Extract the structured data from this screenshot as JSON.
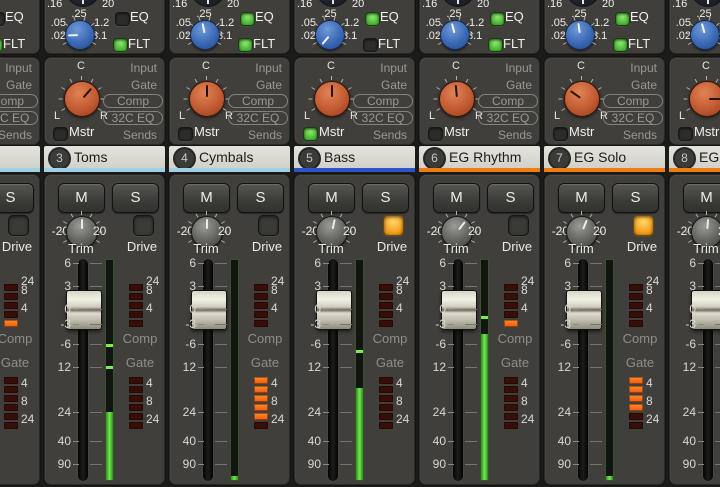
{
  "labels": {
    "top_left": ".16",
    "top_right": "20",
    "eq_scale": [
      ".05",
      ".25",
      "1.2",
      ".02",
      "3.1"
    ],
    "eq": "EQ",
    "flt": "FLT",
    "pan_center": "C",
    "pan_left": "L",
    "pan_right": "R",
    "route_buttons": [
      "Input",
      "Gate",
      "Comp",
      "32C EQ",
      "Sends"
    ],
    "mstr": "Mstr",
    "mute": "M",
    "solo": "S",
    "trim_min": "-20",
    "trim_max": "20",
    "trim": "Trim",
    "drive": "Drive",
    "fader_scale": [
      "6",
      "3",
      "0",
      "-3",
      "-6",
      "12",
      "24",
      "40",
      "90"
    ],
    "comp_title": "Comp",
    "gate_title": "Gate",
    "comp_scale": [
      "24",
      "8",
      "4"
    ],
    "gate_scale": [
      "4",
      "8",
      "24"
    ]
  },
  "channels": [
    {
      "number": "",
      "name": "",
      "accent": "#9fd0e8",
      "eq_angle": -90,
      "eq_led": false,
      "flt_led": true,
      "pan_angle": 0,
      "mstr_led": false,
      "trim_angle": 0,
      "drive_led": false,
      "meter": {
        "fill": 0,
        "peaks": []
      },
      "comp_lit": [
        false,
        false,
        false,
        false,
        true
      ],
      "gate_lit": [
        false,
        false,
        false,
        false,
        false,
        false
      ]
    },
    {
      "number": "3",
      "name": "Toms",
      "accent": "#9fd0e8",
      "eq_angle": -92,
      "eq_led": false,
      "flt_led": true,
      "pan_angle": 42,
      "mstr_led": false,
      "trim_angle": 0,
      "drive_led": false,
      "meter": {
        "fill": 0.31,
        "peaks": [
          0.61,
          0.51
        ]
      },
      "comp_lit": [
        false,
        false,
        false,
        false,
        false
      ],
      "gate_lit": [
        false,
        false,
        false,
        false,
        false,
        false
      ]
    },
    {
      "number": "4",
      "name": "Cymbals",
      "accent": "#9fd0e8",
      "eq_angle": -12,
      "eq_led": true,
      "flt_led": true,
      "pan_angle": 0,
      "mstr_led": false,
      "trim_angle": 0,
      "drive_led": false,
      "meter": {
        "fill": 0.02,
        "peaks": []
      },
      "comp_lit": [
        false,
        false,
        false,
        false,
        false
      ],
      "gate_lit": [
        true,
        true,
        true,
        true,
        true,
        false
      ]
    },
    {
      "number": "5",
      "name": "Bass",
      "accent": "#2b55c8",
      "eq_angle": -140,
      "eq_led": true,
      "flt_led": false,
      "pan_angle": 0,
      "mstr_led": true,
      "trim_angle": 12,
      "drive_led": true,
      "meter": {
        "fill": 0.42,
        "peaks": [
          0.58
        ]
      },
      "comp_lit": [
        false,
        false,
        false,
        false,
        false
      ],
      "gate_lit": [
        false,
        false,
        false,
        false,
        false,
        false
      ]
    },
    {
      "number": "6",
      "name": "EG Rhythm",
      "accent": "#ef7d14",
      "eq_angle": -15,
      "eq_led": true,
      "flt_led": true,
      "pan_angle": -5,
      "mstr_led": false,
      "trim_angle": 38,
      "drive_led": false,
      "meter": {
        "fill": 0.665,
        "peaks": [
          0.735
        ]
      },
      "comp_lit": [
        false,
        false,
        false,
        false,
        true
      ],
      "gate_lit": [
        false,
        false,
        false,
        false,
        false,
        false
      ]
    },
    {
      "number": "7",
      "name": "EG Solo",
      "accent": "#ef7d14",
      "eq_angle": -8,
      "eq_led": true,
      "flt_led": true,
      "pan_angle": -55,
      "mstr_led": false,
      "trim_angle": 22,
      "drive_led": true,
      "meter": {
        "fill": 0.02,
        "peaks": []
      },
      "comp_lit": [
        false,
        false,
        false,
        false,
        false
      ],
      "gate_lit": [
        true,
        true,
        true,
        true,
        false,
        false
      ]
    },
    {
      "number": "8",
      "name": "EG L",
      "accent": "#ef7d14",
      "eq_angle": -15,
      "eq_led": true,
      "flt_led": true,
      "pan_angle": 90,
      "mstr_led": false,
      "trim_angle": 5,
      "drive_led": false,
      "meter": {
        "fill": 0,
        "peaks": []
      },
      "comp_lit": [
        false,
        false,
        false,
        false,
        false
      ],
      "gate_lit": [
        false,
        false,
        false,
        false,
        false,
        false
      ]
    }
  ]
}
